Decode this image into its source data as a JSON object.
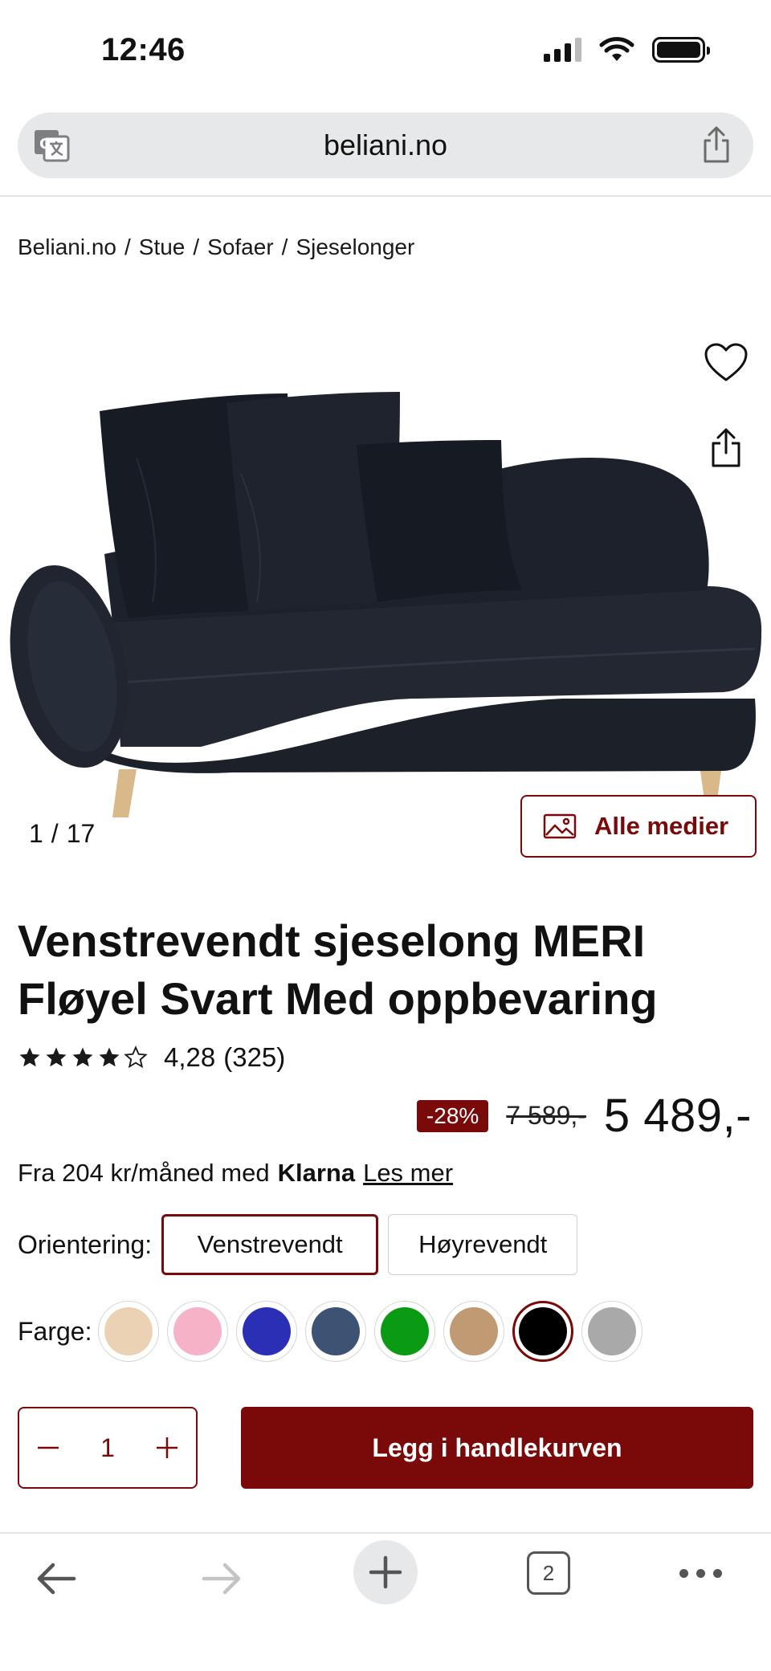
{
  "status_bar": {
    "time": "12:46",
    "icons": [
      "cellular-signal-icon",
      "wifi-icon",
      "battery-icon"
    ]
  },
  "browser": {
    "url": "beliani.no",
    "translate_icon": "translate-icon",
    "share_icon": "share-icon",
    "tab_count": "2",
    "nav_icons": [
      "back-arrow-icon",
      "forward-arrow-icon",
      "plus-icon",
      "tabs-icon",
      "more-icon"
    ]
  },
  "breadcrumb": {
    "items": [
      "Beliani.no",
      "Stue",
      "Sofaer",
      "Sjeselonger"
    ],
    "separator": "/"
  },
  "gallery": {
    "current": "1",
    "separator": "/",
    "total": "17",
    "all_media_label": "Alle medier",
    "image_alt": "Black velvet chaise longue with three cushions and wooden legs"
  },
  "product": {
    "title": "Venstrevendt sjeselong MERI Fløyel Svart Med oppbevaring",
    "rating_value": 4.28,
    "rating_text": "4,28",
    "review_count": "(325)",
    "discount": "-28%",
    "old_price": "7 589,-",
    "price": "5 489,-"
  },
  "klarna": {
    "prefix": "Fra 204 kr/måned med",
    "brand": "Klarna",
    "link": "Les mer"
  },
  "orientation": {
    "label": "Orientering:",
    "options": [
      "Venstrevendt",
      "Høyrevendt"
    ],
    "selected": "Venstrevendt"
  },
  "color": {
    "label": "Farge:",
    "swatches": [
      "#ecd2b4",
      "#f6b3c7",
      "#2a2fb5",
      "#3c5373",
      "#0a9a14",
      "#bf9a72",
      "#000000",
      "#a9a9a9"
    ],
    "selected_index": 6
  },
  "cart": {
    "quantity": "1",
    "add_to_cart_label": "Legg i handlekurven"
  },
  "theme": {
    "accent": "#7a0a0a"
  }
}
